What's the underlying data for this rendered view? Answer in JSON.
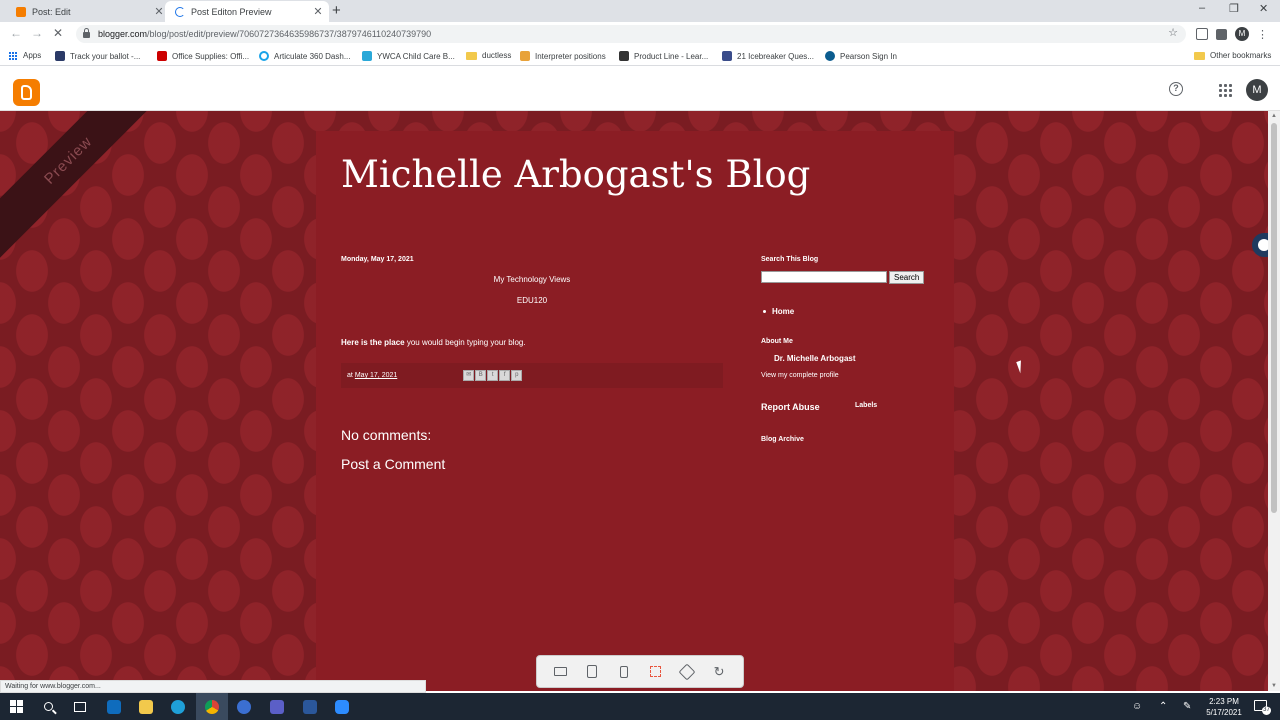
{
  "browser": {
    "tabs": [
      {
        "title": "Post: Edit",
        "active": false
      },
      {
        "title": "Post Editon Preview",
        "active": true
      }
    ],
    "url_domain": "blogger.com",
    "url_path": "/blog/post/edit/preview/7060727364635986737/3879746110240739790",
    "bookmarks": [
      {
        "label": "Apps"
      },
      {
        "label": "Track your ballot -..."
      },
      {
        "label": "Office Supplies: Offi..."
      },
      {
        "label": "Articulate 360 Dash..."
      },
      {
        "label": "YWCA Child Care B..."
      },
      {
        "label": "ductless"
      },
      {
        "label": "Interpreter positions"
      },
      {
        "label": "Product Line - Lear..."
      },
      {
        "label": "21 Icebreaker Ques..."
      },
      {
        "label": "Pearson Sign In"
      }
    ],
    "other_bookmarks": "Other bookmarks",
    "profile_initial": "M",
    "status_text": "Waiting for www.blogger.com..."
  },
  "blogger": {
    "avatar_initial": "M",
    "ribbon_text": "Preview"
  },
  "blog": {
    "title": "Michelle Arbogast's Blog",
    "post": {
      "date": "Monday, May 17, 2021",
      "line1": "My Technology Views",
      "line2": "EDU120",
      "body_bold": "Here is the place",
      "body_rest": " you would begin typing your blog.",
      "footer_at": "at",
      "footer_date": "May 17, 2021"
    },
    "no_comments": "No comments:",
    "post_comment": "Post a Comment",
    "sidebar": {
      "search_title": "Search This Blog",
      "search_button": "Search",
      "home": "Home",
      "about_title": "About Me",
      "author": "Dr. Michelle Arbogast",
      "profile_link": "View my complete profile",
      "report_abuse": "Report Abuse",
      "labels": "Labels",
      "archive": "Blog Archive"
    }
  },
  "taskbar": {
    "time": "2:23 PM",
    "date": "5/17/2021",
    "notifications": "37"
  },
  "colors": {
    "blog_bg": "#8b1d24",
    "page_bg": "#7a1c22",
    "blogger_orange": "#f57d00",
    "taskbar": "#1c2633"
  }
}
